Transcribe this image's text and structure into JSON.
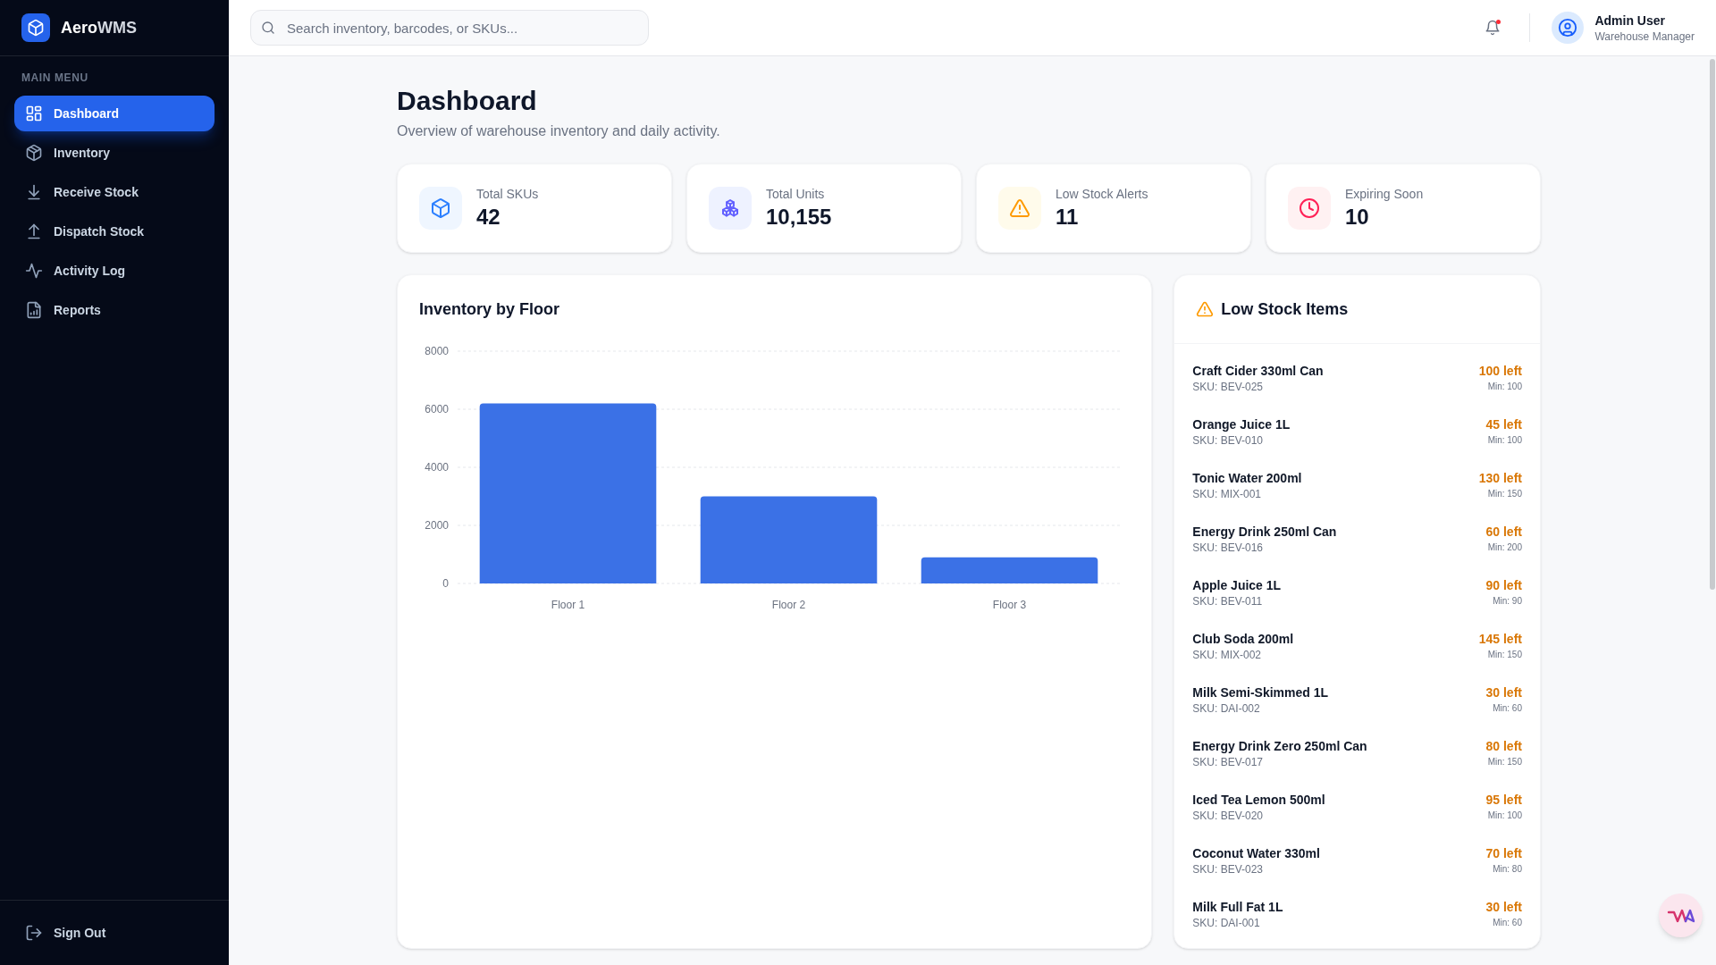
{
  "sidebar": {
    "brand": {
      "name": "Aero",
      "name_suffix": "WMS"
    },
    "section_label": "MAIN MENU",
    "items": [
      {
        "label": "Dashboard",
        "kind": "dashboard",
        "selected": true
      },
      {
        "label": "Inventory",
        "kind": "inventory",
        "selected": false
      },
      {
        "label": "Receive Stock",
        "kind": "receive",
        "selected": false
      },
      {
        "label": "Dispatch Stock",
        "kind": "dispatch",
        "selected": false
      },
      {
        "label": "Activity Log",
        "kind": "activity",
        "selected": false
      },
      {
        "label": "Reports",
        "kind": "reports",
        "selected": false
      }
    ],
    "sign_out": "Sign Out"
  },
  "header": {
    "search": {
      "placeholder": "Search inventory, barcodes, or SKUs..."
    },
    "notifications": {
      "unread": true
    },
    "user": {
      "name": "Admin User",
      "role": "Warehouse Manager"
    }
  },
  "page": {
    "title": "Dashboard",
    "subtitle": "Overview of warehouse inventory and daily activity."
  },
  "stats": [
    {
      "label": "Total SKUs",
      "value": "42",
      "kind": "box"
    },
    {
      "label": "Total Units",
      "value": "10,155",
      "kind": "boxes"
    },
    {
      "label": "Low Stock Alerts",
      "value": "11",
      "kind": "alert"
    },
    {
      "label": "Expiring Soon",
      "value": "10",
      "kind": "clock"
    }
  ],
  "inventory_chart": {
    "chart_data": {
      "type": "bar",
      "title": "Inventory by Floor",
      "categories": [
        "Floor 1",
        "Floor 2",
        "Floor 3"
      ],
      "values": [
        6200,
        3000,
        900
      ],
      "ylim": [
        0,
        8000
      ],
      "yticks": [
        0,
        2000,
        4000,
        6000,
        8000
      ],
      "grid": true
    }
  },
  "low_stock": {
    "title": "Low Stock Items",
    "items": [
      {
        "name": "Craft Cider 330ml Can",
        "sku": "SKU: BEV-025",
        "left": "100 left",
        "min": "Min: 100"
      },
      {
        "name": "Orange Juice 1L",
        "sku": "SKU: BEV-010",
        "left": "45 left",
        "min": "Min: 100"
      },
      {
        "name": "Tonic Water 200ml",
        "sku": "SKU: MIX-001",
        "left": "130 left",
        "min": "Min: 150"
      },
      {
        "name": "Energy Drink 250ml Can",
        "sku": "SKU: BEV-016",
        "left": "60 left",
        "min": "Min: 200"
      },
      {
        "name": "Apple Juice 1L",
        "sku": "SKU: BEV-011",
        "left": "90 left",
        "min": "Min: 90"
      },
      {
        "name": "Club Soda 200ml",
        "sku": "SKU: MIX-002",
        "left": "145 left",
        "min": "Min: 150"
      },
      {
        "name": "Milk Semi-Skimmed 1L",
        "sku": "SKU: DAI-002",
        "left": "30 left",
        "min": "Min: 60"
      },
      {
        "name": "Energy Drink Zero 250ml Can",
        "sku": "SKU: BEV-017",
        "left": "80 left",
        "min": "Min: 150"
      },
      {
        "name": "Iced Tea Lemon 500ml",
        "sku": "SKU: BEV-020",
        "left": "95 left",
        "min": "Min: 100"
      },
      {
        "name": "Coconut Water 330ml",
        "sku": "SKU: BEV-023",
        "left": "70 left",
        "min": "Min: 80"
      },
      {
        "name": "Milk Full Fat 1L",
        "sku": "SKU: DAI-001",
        "left": "30 left",
        "min": "Min: 60"
      }
    ]
  }
}
